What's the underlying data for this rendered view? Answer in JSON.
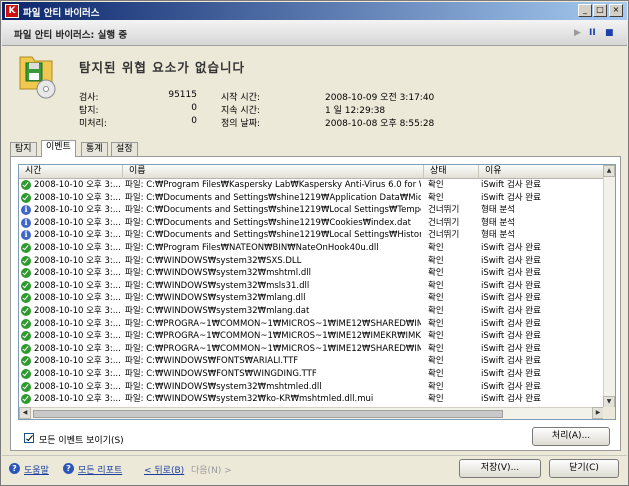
{
  "window": {
    "title": "파일 안티 바이러스"
  },
  "header": {
    "title": "파일 안티 바이러스: 실행 중",
    "controls": {
      "play": "▶",
      "pause": "II",
      "stop": "■"
    }
  },
  "summary": {
    "headline": "탐지된 위협 요소가 없습니다",
    "stats": [
      {
        "label": "검사:",
        "value": "95115"
      },
      {
        "label": "탐지:",
        "value": "0"
      },
      {
        "label": "미처리:",
        "value": "0"
      }
    ],
    "times": [
      {
        "label": "시작 시간:",
        "value": "2008-10-09 오전 3:17:40"
      },
      {
        "label": "지속 시간:",
        "value": "1 일 12:29:38"
      },
      {
        "label": "정의 날짜:",
        "value": "2008-10-08 오후 8:55:28"
      }
    ]
  },
  "tabs": [
    "탐지",
    "이벤트",
    "통계",
    "설정"
  ],
  "table": {
    "columns": [
      "시간",
      "이름",
      "상태",
      "이유"
    ],
    "rows": [
      {
        "icon": "ok",
        "time": "2008-10-10 오후 3:...",
        "name": "파일: C:₩Program Files₩Kaspersky Lab₩Kaspersky Anti-Virus 6.0 for Wind...",
        "status": "확인",
        "reason": "iSwift 검사 완료"
      },
      {
        "icon": "ok",
        "time": "2008-10-10 오후 3:...",
        "name": "파일: C:₩Documents and Settings₩shine1219₩Application Data₩Microsoft...",
        "status": "확인",
        "reason": "iSwift 검사 완료"
      },
      {
        "icon": "info",
        "time": "2008-10-10 오후 3:...",
        "name": "파일: C:₩Documents and Settings₩shine1219₩Local Settings₩Temporary ...",
        "status": "건너뛰기",
        "reason": "형태 분석"
      },
      {
        "icon": "info",
        "time": "2008-10-10 오후 3:...",
        "name": "파일: C:₩Documents and Settings₩shine1219₩Cookies₩index.dat",
        "status": "건너뛰기",
        "reason": "형태 분석"
      },
      {
        "icon": "info",
        "time": "2008-10-10 오후 3:...",
        "name": "파일: C:₩Documents and Settings₩shine1219₩Local Settings₩History₩Hi...",
        "status": "건너뛰기",
        "reason": "형태 분석"
      },
      {
        "icon": "ok",
        "time": "2008-10-10 오후 3:...",
        "name": "파일: C:₩Program Files₩NATEON₩BIN₩NateOnHook40u.dll",
        "status": "확인",
        "reason": "iSwift 검사 완료"
      },
      {
        "icon": "ok",
        "time": "2008-10-10 오후 3:...",
        "name": "파일: C:₩WINDOWS₩system32₩SXS.DLL",
        "status": "확인",
        "reason": "iSwift 검사 완료"
      },
      {
        "icon": "ok",
        "time": "2008-10-10 오후 3:...",
        "name": "파일: C:₩WINDOWS₩system32₩mshtml.dll",
        "status": "확인",
        "reason": "iSwift 검사 완료"
      },
      {
        "icon": "ok",
        "time": "2008-10-10 오후 3:...",
        "name": "파일: C:₩WINDOWS₩system32₩msls31.dll",
        "status": "확인",
        "reason": "iSwift 검사 완료"
      },
      {
        "icon": "ok",
        "time": "2008-10-10 오후 3:...",
        "name": "파일: C:₩WINDOWS₩system32₩mlang.dll",
        "status": "확인",
        "reason": "iSwift 검사 완료"
      },
      {
        "icon": "ok",
        "time": "2008-10-10 오후 3:...",
        "name": "파일: C:₩WINDOWS₩system32₩mlang.dat",
        "status": "확인",
        "reason": "iSwift 검사 완료"
      },
      {
        "icon": "ok",
        "time": "2008-10-10 오후 3:...",
        "name": "파일: C:₩PROGRA~1₩COMMON~1₩MICROS~1₩IME12₩SHARED₩IMET...",
        "status": "확인",
        "reason": "iSwift 검사 완료"
      },
      {
        "icon": "ok",
        "time": "2008-10-10 오후 3:...",
        "name": "파일: C:₩PROGRA~1₩COMMON~1₩MICROS~1₩IME12₩IMEKR₩IMKRA...",
        "status": "확인",
        "reason": "iSwift 검사 완료"
      },
      {
        "icon": "ok",
        "time": "2008-10-10 오후 3:...",
        "name": "파일: C:₩PROGRA~1₩COMMON~1₩MICROS~1₩IME12₩SHARED₩IMJK...",
        "status": "확인",
        "reason": "iSwift 검사 완료"
      },
      {
        "icon": "ok",
        "time": "2008-10-10 오후 3:...",
        "name": "파일: C:₩WINDOWS₩FONTS₩ARIALI.TTF",
        "status": "확인",
        "reason": "iSwift 검사 완료"
      },
      {
        "icon": "ok",
        "time": "2008-10-10 오후 3:...",
        "name": "파일: C:₩WINDOWS₩FONTS₩WINGDING.TTF",
        "status": "확인",
        "reason": "iSwift 검사 완료"
      },
      {
        "icon": "ok",
        "time": "2008-10-10 오후 3:...",
        "name": "파일: C:₩WINDOWS₩system32₩mshtmled.dll",
        "status": "확인",
        "reason": "iSwift 검사 완료"
      },
      {
        "icon": "ok",
        "time": "2008-10-10 오후 3:...",
        "name": "파일: C:₩WINDOWS₩system32₩ko-KR₩mshtmled.dll.mui",
        "status": "확인",
        "reason": "iSwift 검사 완료"
      }
    ]
  },
  "options": {
    "show_all_events": "모든 이벤트 보이기(S)",
    "process_button": "처리(A)..."
  },
  "footer": {
    "help": "도움말",
    "all_reports": "모든 리포트",
    "back": "< 뒤로(B)",
    "next": "다음(N) >",
    "save": "저장(V)...",
    "close": "닫기(C)"
  },
  "colors": {
    "title_bar": "#0a246a",
    "link": "#1a3f9e",
    "ok_icon": "#2e9a2e",
    "info_icon": "#3f66c8"
  },
  "icons": {
    "app": "kaspersky-k-icon",
    "summary": "folder-disk-icon",
    "ok": "check-circle-icon",
    "info": "info-circle-icon",
    "help": "question-circle-icon"
  }
}
